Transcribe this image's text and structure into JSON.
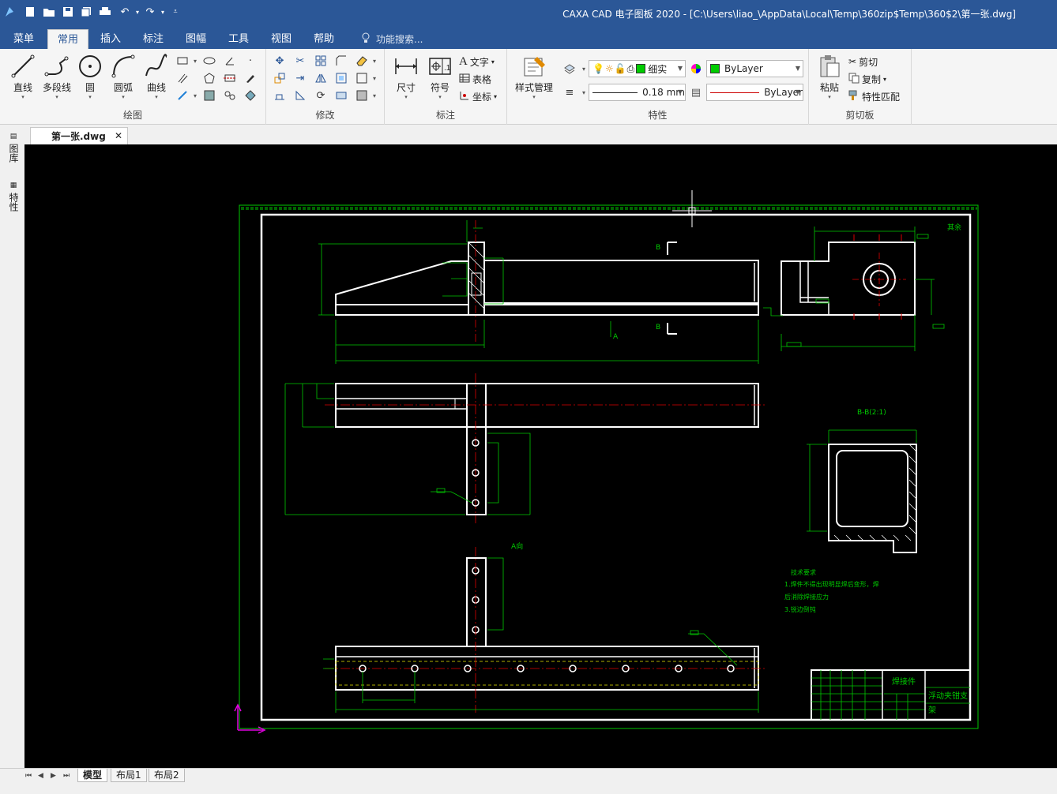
{
  "window": {
    "title": "CAXA CAD 电子图板 2020 - [C:\\Users\\liao_\\AppData\\Local\\Temp\\360zip$Temp\\360$2\\第一张.dwg]"
  },
  "menu": {
    "tabs": [
      "菜单",
      "常用",
      "插入",
      "标注",
      "图幅",
      "工具",
      "视图",
      "帮助"
    ],
    "active_tab": "常用",
    "search_placeholder": "功能搜索..."
  },
  "ribbon": {
    "draw": {
      "label": "绘图",
      "buttons": [
        "直线",
        "多段线",
        "圆",
        "圆弧",
        "曲线"
      ]
    },
    "modify": {
      "label": "修改"
    },
    "annotate": {
      "label": "标注",
      "buttons": [
        "尺寸",
        "符号"
      ],
      "small": [
        "文字",
        "表格",
        "坐标"
      ]
    },
    "properties": {
      "label": "特性",
      "style_manager": "样式管理",
      "layer_value": "细实",
      "color_value": "ByLayer",
      "lineweight_value": "0.18 mm",
      "linetype_value": "ByLayer",
      "layer_color": "#00cc00"
    },
    "clipboard": {
      "label": "剪切板",
      "paste": "粘贴",
      "cut": "剪切",
      "copy": "复制",
      "match": "特性匹配"
    }
  },
  "document": {
    "tab_name": "第一张.dwg"
  },
  "side_panel": {
    "items": [
      "图库",
      "特性"
    ]
  },
  "drawing": {
    "section_label": "B-B(2:1)",
    "view_label_a": "A向",
    "label_b": "B",
    "label_a": "A",
    "notes_title": "技术要求",
    "notes": [
      "1.焊件不得出现明显焊后变形，焊",
      "后消除焊接应力",
      "3.锐边倒钝"
    ],
    "title_block_name": "焊接件",
    "title_block_part": "浮动夹钳支",
    "title_block_part2": "架",
    "corner_note": "其余"
  },
  "layout_tabs": {
    "tabs": [
      "模型",
      "布局1",
      "布局2"
    ],
    "active": "模型"
  }
}
